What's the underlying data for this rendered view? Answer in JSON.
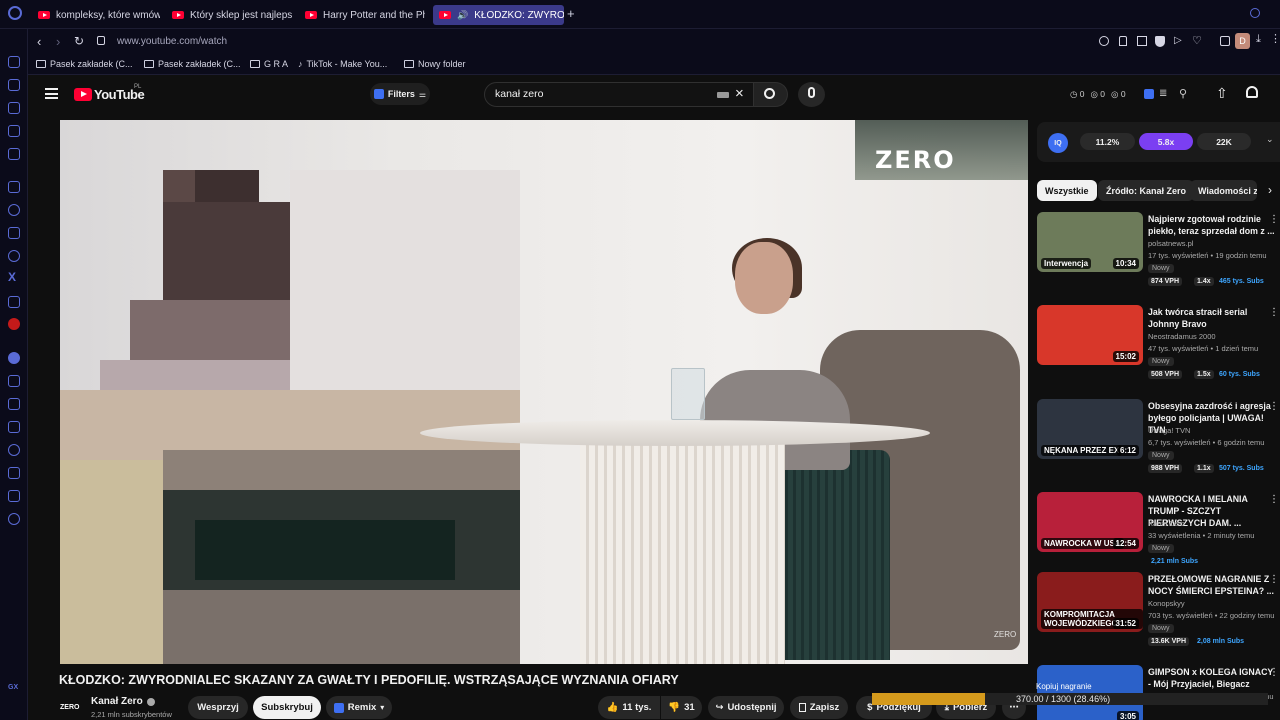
{
  "browser": {
    "tabs": [
      {
        "label": "kompleksy, które wmówiły"
      },
      {
        "label": "Który sklep jest najlepszy"
      },
      {
        "label": "Harry Potter and the Philo"
      },
      {
        "label": "KŁODZKO: ZWYRODN"
      }
    ],
    "new_tab": "+",
    "url": "www.youtube.com/watch",
    "bookmarks": [
      "Pasek zakładek (C...",
      "Pasek zakładek (C...",
      "G R A",
      "TikTok - Make You...",
      "Nowy folder"
    ],
    "profile_letter": "D"
  },
  "youtube": {
    "logo": "YouTube",
    "region": "PL",
    "filters_label": "Filters",
    "search_value": "kanał zero",
    "header_counters": [
      "0",
      "0",
      "0"
    ]
  },
  "video": {
    "watermark": "ZERO",
    "watermark_small": "ZERO",
    "title": "KŁODZKO: ZWYRODNIALEC SKAZANY ZA GWAŁTY I PEDOFILIĘ. WSTRZĄSAJĄCE WYZNANIA OFIARY",
    "channel_logo": "ZERO",
    "channel": "Kanał Zero",
    "subscribers": "2,21 mln subskrybentów",
    "support_label": "Wesprzyj",
    "subscribe_label": "Subskrybuj",
    "remix_label": "Remix",
    "likes": "11 tys.",
    "dislikes": "31",
    "share_label": "Udostępnij",
    "save_label": "Zapisz",
    "thanks_label": "Podziękuj",
    "download_label": "Pobierz"
  },
  "extension": {
    "logo": "IQ",
    "pills": [
      "11.2%",
      "5.8x",
      "22K"
    ],
    "active_pill_color": "#7b3ff2"
  },
  "chips": [
    "Wszystkie",
    "Źródło: Kanał Zero",
    "Wiadomości z"
  ],
  "recommendations": [
    {
      "title": "Najpierw zgotował rodzinie piekło, teraz sprzedał dom z ...",
      "channel": "polsatnews.pl",
      "meta": "17 tys. wyświetleń • 19 godzin temu",
      "badge": "Nowy",
      "duration": "10:34",
      "thumb_label": "Interwencja",
      "vph": "874 VPH",
      "mult": "1.4x",
      "subs": "465 tys. Subs",
      "thumb_color": "#6d7b5a"
    },
    {
      "title": "Jak twórca stracił serial Johnny Bravo",
      "channel": "Neostradamus 2000",
      "meta": "47 tys. wyświetleń • 1 dzień temu",
      "badge": "Nowy",
      "duration": "15:02",
      "thumb_label": "",
      "vph": "508 VPH",
      "mult": "1.5x",
      "subs": "60 tys. Subs",
      "thumb_color": "#d8372a"
    },
    {
      "title": "Obsesyjna zazdrość i agresja byłego policjanta | UWAGA! TVN",
      "channel": "Uwaga! TVN",
      "meta": "6,7 tys. wyświetleń • 6 godzin temu",
      "badge": "Nowy",
      "duration": "6:12",
      "thumb_label": "NĘKANA PRZEZ EX",
      "vph": "988 VPH",
      "mult": "1.1x",
      "subs": "507 tys. Subs",
      "thumb_color": "#2d3440"
    },
    {
      "title": "NAWROCKA I MELANIA TRUMP - SZCZYT PIERWSZYCH DAM. ...",
      "channel": "Kanał Zero",
      "meta": "33 wyświetlenia • 2 minuty temu",
      "badge": "Nowy",
      "duration": "12:54",
      "thumb_label": "NAWROCKA W USA",
      "vph": "",
      "mult": "",
      "subs": "2,21 mln Subs",
      "thumb_color": "#b8203a"
    },
    {
      "title": "PRZEŁOMOWE NAGRANIE Z NOCY ŚMIERCI EPSTEINA? ...",
      "channel": "Konopskyy",
      "meta": "703 tys. wyświetleń • 22 godziny temu",
      "badge": "Nowy",
      "duration": "31:52",
      "thumb_label": "KOMPROMITACJA WOJEWÓDZKIEGO",
      "vph": "13.6K VPH",
      "mult": "",
      "subs": "2,08 mln Subs",
      "thumb_color": "#8a1c1c"
    },
    {
      "title": "GIMPSON x KOLEGA IGNACY - Mój Przyjaciel, Biegacz",
      "channel": "",
      "meta": "381 tys. wyświetleń • 6 miesięcy temu",
      "badge": "",
      "duration": "3:05",
      "thumb_label": "",
      "vph": "",
      "mult": "",
      "subs": "",
      "thumb_color": "#2b61c9"
    }
  ],
  "download_overlay": {
    "label": "Kopiuj nagranie",
    "progress_text": "370.00 / 1300 (28.46%)",
    "progress_percent": 28.46,
    "color": "#d59a1c"
  }
}
